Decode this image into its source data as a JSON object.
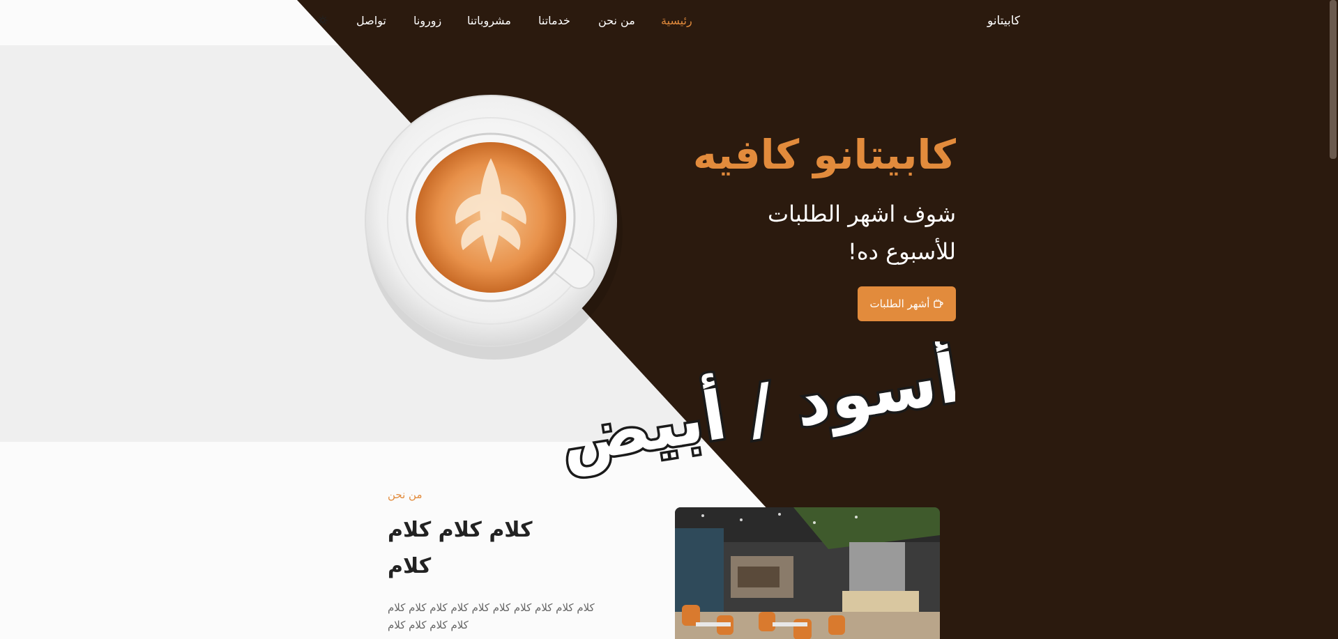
{
  "nav": {
    "brand": "كابيتانو",
    "links": [
      {
        "label": "رئيسية",
        "active": true
      },
      {
        "label": "من نحن",
        "active": false
      },
      {
        "label": "خدماتنا",
        "active": false
      },
      {
        "label": "مشروباتنا",
        "active": false
      },
      {
        "label": "زورونا",
        "active": false
      },
      {
        "label": "تواصل",
        "active": false
      }
    ],
    "theme_icon": "sun-icon"
  },
  "hero": {
    "title": "كابيتانو كافيه",
    "subtitle": "شوف اشهر الطلبات للأسبوع ده!",
    "button_label": "أشهر الطلبات",
    "button_icon": "coffee-cup-icon"
  },
  "overlay": {
    "text": "أسود / أبيض"
  },
  "about": {
    "eyebrow": "من نحن",
    "title": "كلام كلام كلام كلام",
    "body": "كلام كلام كلام كلام كلام كلام كلام كلام كلام كلام كلام كلام كلام كلام"
  },
  "colors": {
    "accent": "#e28b3c",
    "dark": "#2b1a0e",
    "light_grey": "#efefef",
    "white": "#fbfbfb"
  }
}
